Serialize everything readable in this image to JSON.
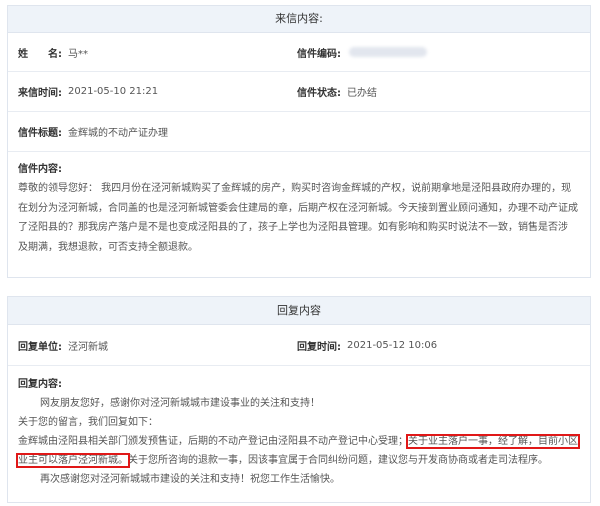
{
  "letter": {
    "header": "来信内容:",
    "name_label": "姓　　名:",
    "name_value": "马**",
    "code_label": "信件编码:",
    "time_label": "来信时间:",
    "time_value": "2021-05-10 21:21",
    "status_label": "信件状态:",
    "status_value": "已办结",
    "subject_label": "信件标题:",
    "subject_value": "金辉城的不动产证办理",
    "content_label": "信件内容:",
    "content_lines": [
      "尊敬的领导您好：  我四月份在泾河新城购买了金辉城的房产，购买时咨询金辉城的产权，说前期拿地是泾阳县政府办理的，现",
      "在划分为泾河新城，合同盖的也是泾河新城管委会住建局的章，后期产权在泾河新城。今天接到置业顾问通知，办理不动产证成",
      "了泾阳县的？那我房产落户是不是也变成泾阳县的了，孩子上学也为泾阳县管理。如有影响和购买时说法不一致，销售是否涉",
      "及期满，我想退款，可否支持全额退款。"
    ]
  },
  "reply": {
    "header": "回复内容",
    "unit_label": "回复单位:",
    "unit_value": "泾河新城",
    "time_label": "回复时间:",
    "time_value": "2021-05-12 10:06",
    "content_label": "回复内容:",
    "line1": "网友朋友您好，感谢你对泾河新城城市建设事业的关注和支持！",
    "line2": "关于您的留言，我们回复如下：",
    "line3_a": "金辉城由泾阳县相关部门颁发预售证，后期的不动产登记由泾阳县不动产登记中心受理；",
    "line3_b": "关于业主落户一事，经了解，目前小区",
    "line4_a": "业主可以落户泾河新城。",
    "line4_b": "关于您所咨询的退款一事，因该事宜属于合同纠纷问题，建议您与开发商协商或者走司法程序。",
    "line5": "再次感谢您对泾河新城城市建设的关注和支持！祝您工作生活愉快。"
  }
}
